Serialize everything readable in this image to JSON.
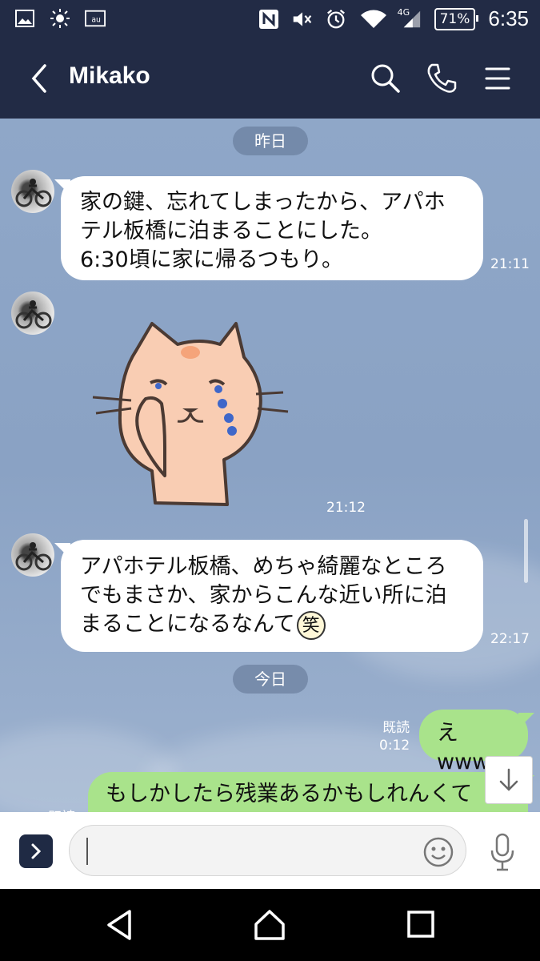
{
  "status_bar": {
    "carrier": "au",
    "network": "4G",
    "battery": "71%",
    "time": "6:35",
    "icons": [
      "gallery-icon",
      "brightness-icon",
      "au-icon",
      "nfc-icon",
      "mute-icon",
      "alarm-icon",
      "wifi-icon",
      "signal-icon"
    ]
  },
  "header": {
    "title": "Mikako",
    "back_icon": "chevron-left-icon",
    "actions": [
      "search-icon",
      "phone-icon",
      "menu-icon"
    ]
  },
  "chat": {
    "date_dividers": [
      "昨日",
      "今日"
    ],
    "messages": [
      {
        "side": "in",
        "text": "家の鍵、忘れてしまったから、アパホテル板橋に泊まることにした。6:30頃に家に帰るつもり。",
        "lines": [
          "家の鍵、忘れてしまったから、アパホ",
          "テル板橋に泊まることにした。",
          "6:30頃に家に帰るつもり。"
        ],
        "time": "21:11"
      },
      {
        "side": "in",
        "type": "sticker",
        "sticker": "crying-cat-sticker",
        "time": "21:12"
      },
      {
        "side": "in",
        "text": "アパホテル板橋、めちゃ綺麗なところでもまさか、家からこんな近い所に泊まることになるなんて",
        "lines": [
          "アパホテル板橋、めちゃ綺麗なところ",
          "でもまさか、家からこんな近い所に泊",
          "まることになるなんて"
        ],
        "emoji": "笑",
        "time": "22:17"
      },
      {
        "side": "out",
        "text": "えwww",
        "read": "既読",
        "time": "0:12"
      },
      {
        "side": "out",
        "text": "もしかしたら残業あるかもしれんくて",
        "read": "既読",
        "time": ""
      }
    ]
  },
  "input": {
    "placeholder": "",
    "icons": [
      "chevron-right-icon",
      "emoji-icon",
      "microphone-icon"
    ]
  },
  "nav": [
    "back-triangle-icon",
    "home-icon",
    "recents-icon"
  ],
  "colors": {
    "header": "#222b45",
    "bubble_out": "#a9e38b",
    "bubble_in": "#ffffff"
  }
}
